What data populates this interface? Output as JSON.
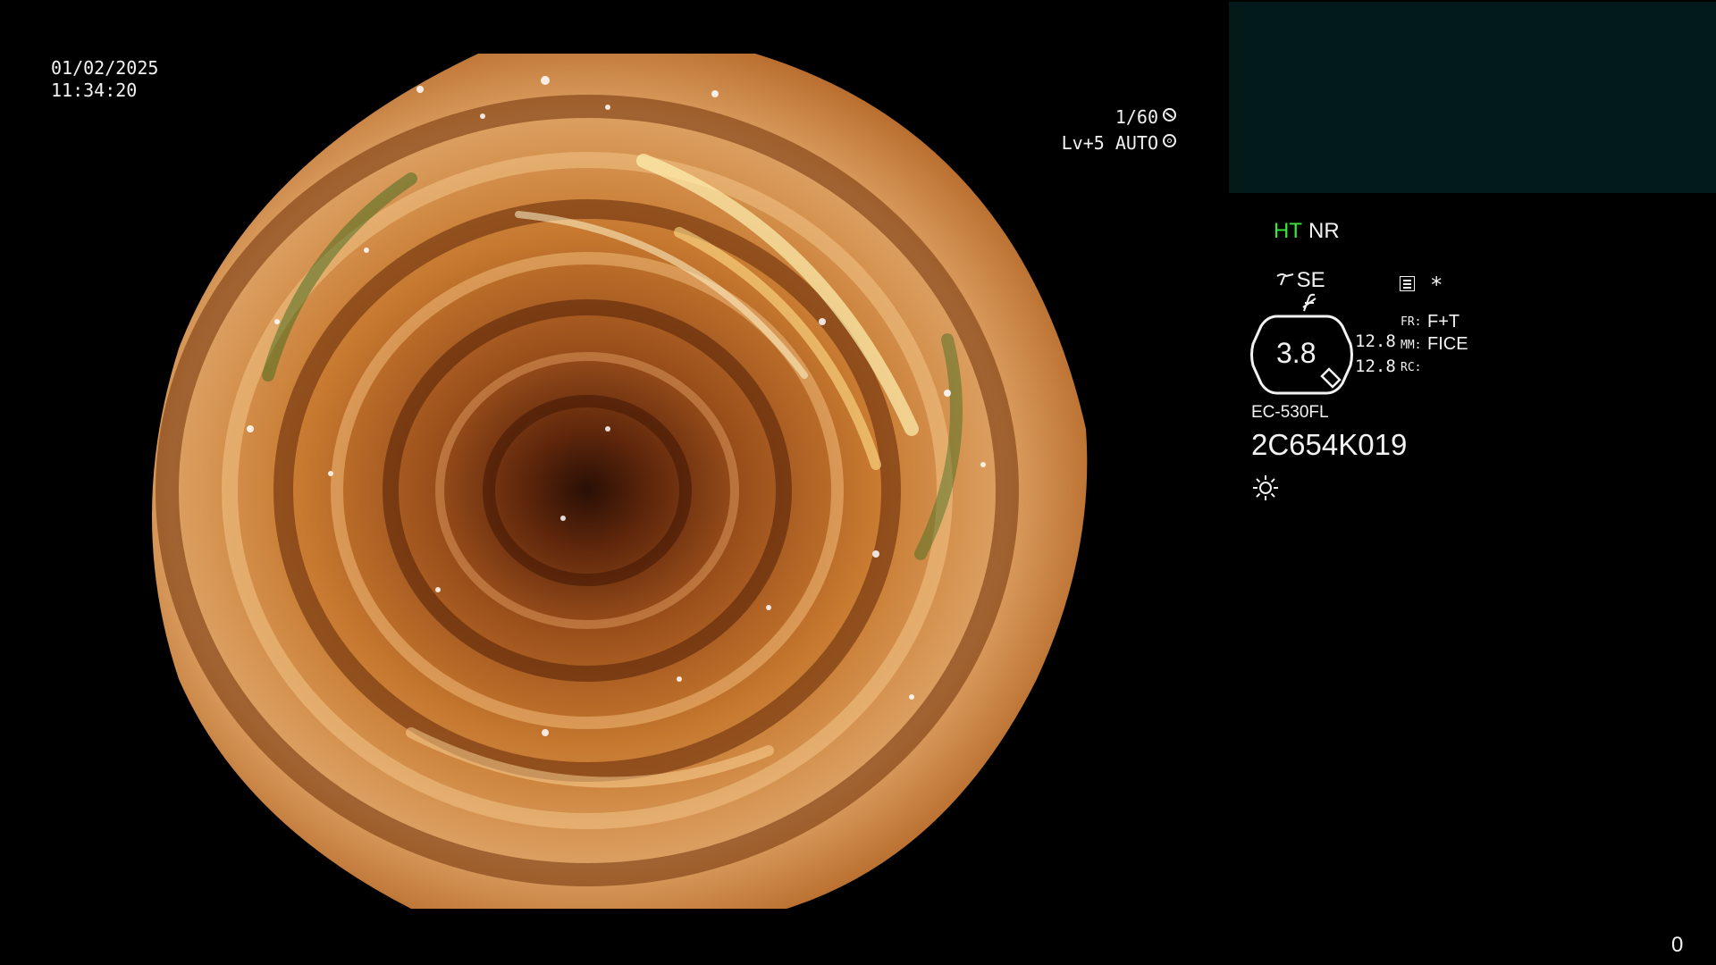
{
  "header": {
    "date": "01/02/2025",
    "time": "11:34:20"
  },
  "exposure": {
    "shutter": "1/60",
    "shutter_icon": "shutter-icon",
    "agc": "Lv+5 AUTO",
    "agc_icon": "iris-icon"
  },
  "status": {
    "ht_label": "HT",
    "ht_color": "#3ce63c",
    "nr_label": "NR",
    "se_label": "SE",
    "se_icon": "stylus-icon",
    "flash_icon": "slashed-f-icon",
    "menu_icon": "menu-icon",
    "asterisk": "*"
  },
  "zoom": {
    "value": "3.8",
    "val1": "12.8",
    "val2": "12.8"
  },
  "modes": {
    "fr_label": "FR:",
    "fr_value": "F+T",
    "mm_label": "MM:",
    "mm_value": "FICE",
    "rc_label": "RC:"
  },
  "scope": {
    "model": "EC-530FL",
    "serial": "2C654K019",
    "light_icon": "sun-icon"
  },
  "counter": "0",
  "colors": {
    "background": "#000000",
    "thumb_panel": "#031a1a",
    "text": "#f2f2f2"
  }
}
